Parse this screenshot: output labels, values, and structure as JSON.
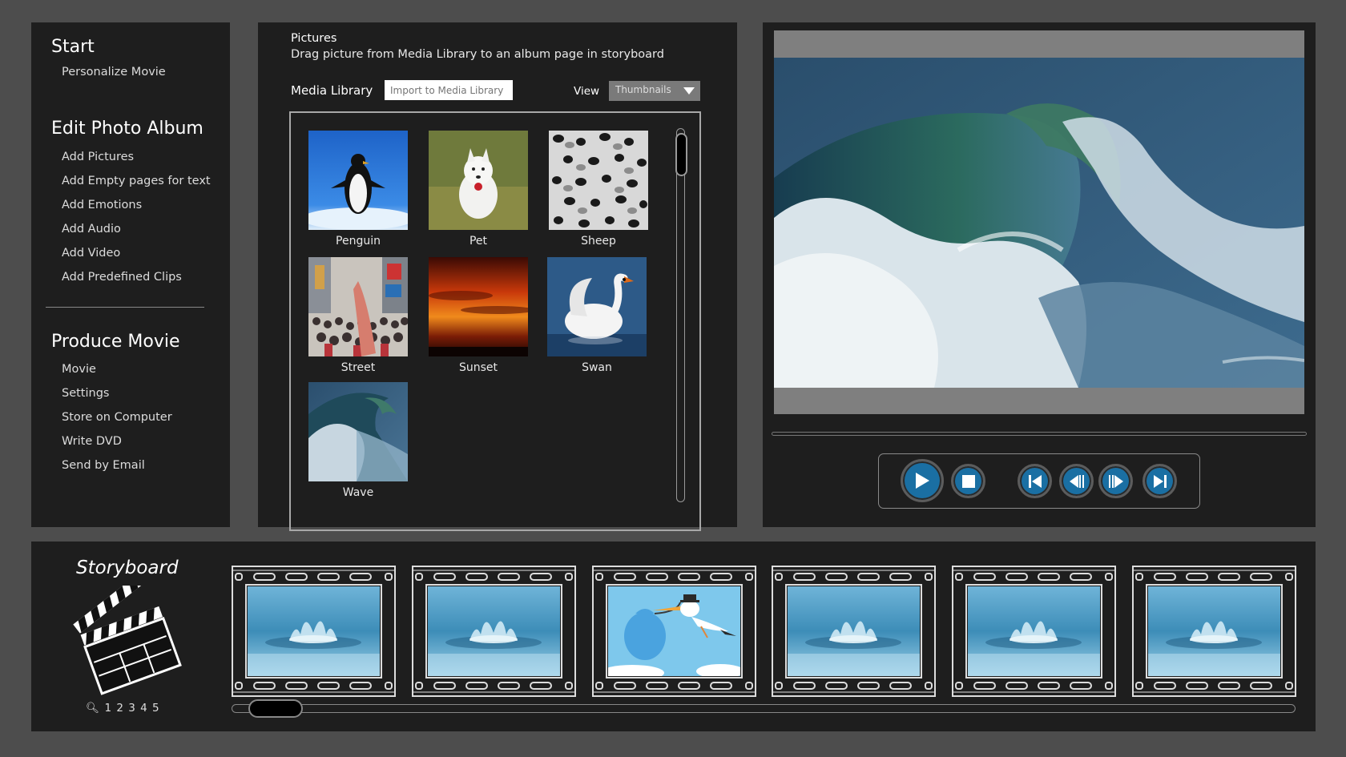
{
  "nav": {
    "start": {
      "title": "Start",
      "items": [
        "Personalize Movie"
      ]
    },
    "edit": {
      "title": "Edit Photo Album",
      "items": [
        "Add Pictures",
        "Add Empty pages for text",
        "Add Emotions",
        "Add Audio",
        "Add Video",
        "Add Predefined Clips"
      ]
    },
    "produce": {
      "title": "Produce Movie",
      "items": [
        "Movie",
        "Settings",
        "Store on Computer",
        "Write DVD",
        "Send by Email"
      ]
    }
  },
  "media": {
    "heading": "Pictures",
    "instruction": "Drag picture from Media Library to an album page in storyboard",
    "library_label": "Media Library",
    "import_placeholder": "Import to Media Library",
    "view_label": "View",
    "view_value": "Thumbnails",
    "thumbnails": [
      "Penguin",
      "Pet",
      "Sheep",
      "Street",
      "Sunset",
      "Swan",
      "Wave"
    ]
  },
  "preview": {
    "controls": [
      "play-icon",
      "stop-icon",
      "skip-start-icon",
      "step-back-icon",
      "step-forward-icon",
      "skip-end-icon"
    ]
  },
  "storyboard": {
    "title": "Storyboard",
    "pages": "1 2 3 4 5",
    "frames": [
      "water-drop",
      "water-drop",
      "stork-baby",
      "water-drop",
      "water-drop",
      "water-drop"
    ]
  },
  "colors": {
    "panel": "#1e1e1e",
    "background": "#4d4d4d",
    "button": "#1a6fa3"
  }
}
